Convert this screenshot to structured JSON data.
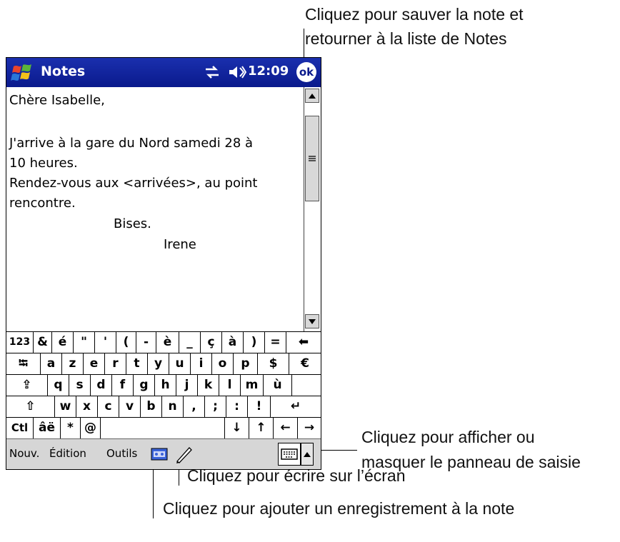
{
  "callouts": {
    "save": [
      "Cliquez pour sauver la note et",
      "retourner à la liste de Notes"
    ],
    "input_panel": [
      "Cliquez pour afficher ou",
      "masquer le panneau de saisie"
    ],
    "write": "Cliquez pour écrire sur l’écran",
    "record": "Cliquez pour ajouter un enregistrement à la note"
  },
  "titlebar": {
    "title": "Notes",
    "time": "12:09",
    "ok_label": "ok",
    "color": "#0a1a8c"
  },
  "note": {
    "lines": [
      "Chère Isabelle,",
      "",
      "J'arrive à la gare du Nord samedi 28 à",
      "10 heures.",
      "Rendez-vous aux <arrivées>, au point",
      "rencontre.",
      "Bises.",
      "Irene"
    ]
  },
  "keyboard": {
    "rows": [
      [
        "123",
        "&",
        "é",
        "\"",
        "'",
        "(",
        "-",
        "è",
        "_",
        "ç",
        "à",
        ")",
        "=",
        "⬅"
      ],
      [
        "⭾",
        "a",
        "z",
        "e",
        "r",
        "t",
        "y",
        "u",
        "i",
        "o",
        "p",
        "$",
        "€"
      ],
      [
        "⇪",
        "q",
        "s",
        "d",
        "f",
        "g",
        "h",
        "j",
        "k",
        "l",
        "m",
        "ù"
      ],
      [
        "⇧",
        "w",
        "x",
        "c",
        "v",
        "b",
        "n",
        ",",
        ";",
        ":",
        "!",
        "↵"
      ],
      [
        "Ctl",
        "âë",
        "*",
        "@",
        "",
        "↓",
        "↑",
        "←",
        "→"
      ]
    ]
  },
  "menubar": {
    "items": [
      "Nouv.",
      "Édition",
      "Outils"
    ],
    "icons": [
      "recording-icon",
      "pen-icon",
      "keyboard-icon",
      "arrow-up-icon"
    ]
  }
}
